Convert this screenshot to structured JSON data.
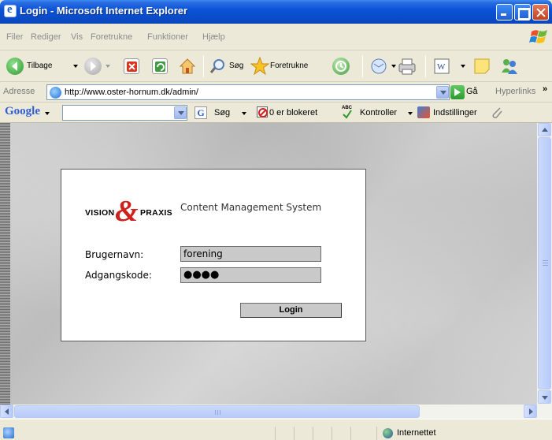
{
  "window": {
    "title": "Login - Microsoft Internet Explorer"
  },
  "menu": {
    "items": [
      "Filer",
      "Rediger",
      "Vis",
      "Foretrukne",
      "Funktioner",
      "Hjælp"
    ]
  },
  "toolbar": {
    "back_label": "Tilbage",
    "search_label": "Søg",
    "favorites_label": "Foretrukne"
  },
  "address": {
    "label": "Adresse",
    "url": "http://www.oster-hornum.dk/admin/",
    "go_label": "Gå",
    "links_label": "Hyperlinks",
    "chevron": "»"
  },
  "google": {
    "logo": "Google",
    "search_label": "Søg",
    "blocked_label": "0 er blokeret",
    "check_label": "Kontroller",
    "settings_label": "Indstillinger",
    "abc_badge": "ABC"
  },
  "login": {
    "logo_left": "VISION",
    "logo_ampersand": "&",
    "logo_right": "PRAXIS",
    "cms_title": "Content Management System",
    "username_label": "Brugernavn:",
    "username_value": "forening",
    "password_label": "Adgangskode:",
    "password_value": "●●●●",
    "login_button": "Login"
  },
  "status": {
    "zone": "Internettet"
  },
  "colors": {
    "titlebar_blue": "#0b53d8",
    "logo_red": "#d0201b",
    "field_gray": "#c9c9c9"
  }
}
